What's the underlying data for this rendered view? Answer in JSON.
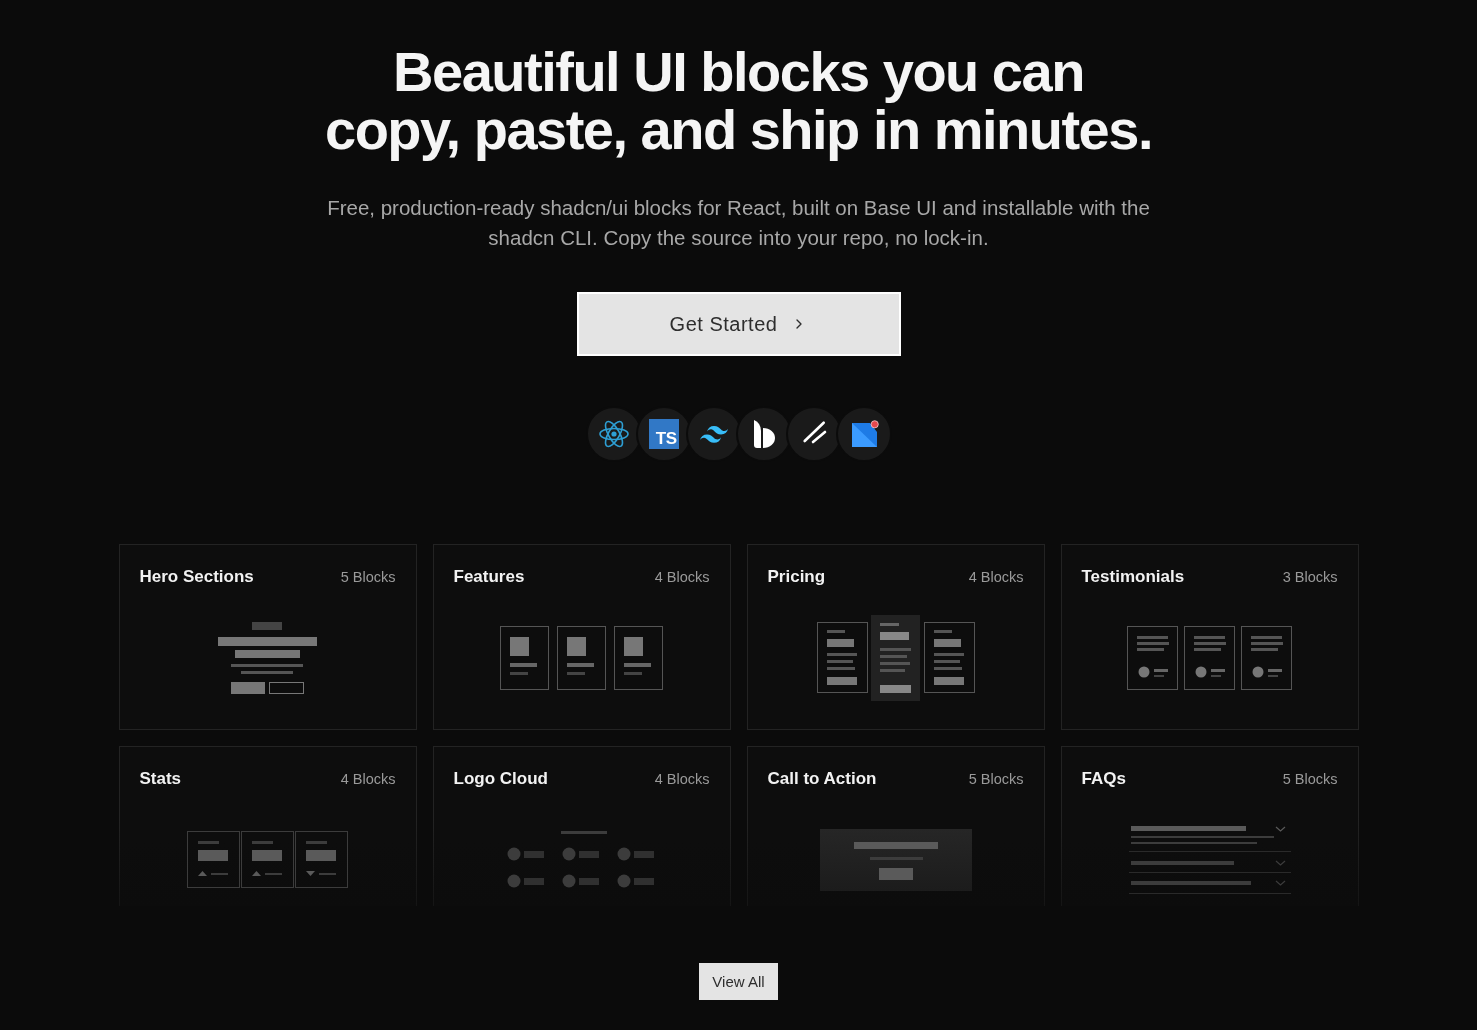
{
  "hero": {
    "title": "Beautiful UI blocks you can\ncopy, paste, and ship in minutes.",
    "subtitle": "Free, production-ready shadcn/ui blocks for React, built on Base UI and installable with the\nshadcn CLI. Copy the source into your repo, no lock-in.",
    "cta": "Get Started"
  },
  "stack_logos": {
    "typescript_label": "TS"
  },
  "categories": [
    {
      "kind": "hero",
      "title": "Hero Sections",
      "count": "5 Blocks"
    },
    {
      "kind": "features",
      "title": "Features",
      "count": "4 Blocks"
    },
    {
      "kind": "pricing",
      "title": "Pricing",
      "count": "4 Blocks"
    },
    {
      "kind": "testimonials",
      "title": "Testimonials",
      "count": "3 Blocks"
    },
    {
      "kind": "stats",
      "title": "Stats",
      "count": "4 Blocks"
    },
    {
      "kind": "logo_cloud",
      "title": "Logo Cloud",
      "count": "4 Blocks"
    },
    {
      "kind": "cta",
      "title": "Call to Action",
      "count": "5 Blocks"
    },
    {
      "kind": "faq",
      "title": "FAQs",
      "count": "5 Blocks"
    }
  ],
  "view_all": "View All"
}
